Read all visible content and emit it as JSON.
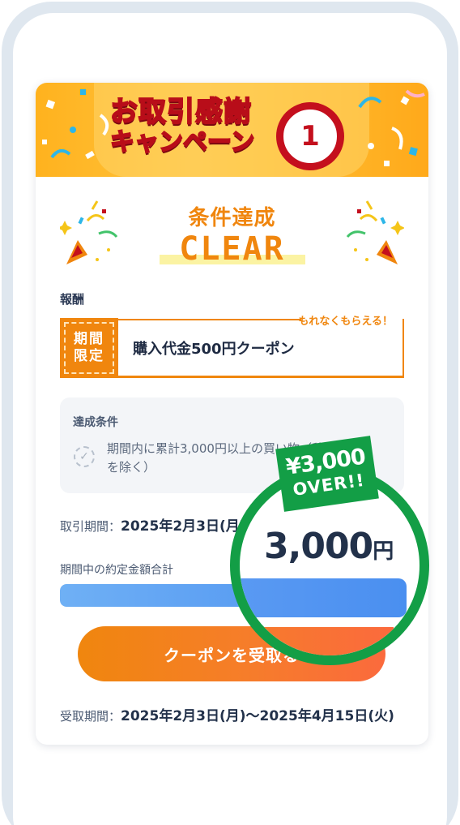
{
  "banner": {
    "title_line1": "お取引感謝",
    "title_line2": "キャンペーン",
    "number": "1"
  },
  "status": {
    "title": "条件達成",
    "label": "CLEAR"
  },
  "reward": {
    "section_label": "報酬",
    "note": "もれなくもらえる！",
    "badge_line1": "期間",
    "badge_line2": "限定",
    "text": "購入代金500円クーポン"
  },
  "condition": {
    "title": "達成条件",
    "text": "期間内に累計3,000円以上の買い物（積立てを除く）"
  },
  "trade_period": {
    "label": "取引期間：",
    "value": "2025年2月3日(月)〜2025年3月3日(月)"
  },
  "total": {
    "label": "期間中の約定金額合計",
    "progress_fraction": 1.0
  },
  "cta": {
    "label": "クーポンを受取る"
  },
  "receive_period": {
    "label": "受取期間：",
    "value": "2025年2月3日(月)〜2025年4月15日(火)"
  },
  "magnifier": {
    "amount": "3,000",
    "unit": "円",
    "badge_line1": "¥3,000",
    "badge_line2": "OVER!!"
  },
  "colors": {
    "accent_orange": "#f0860e",
    "accent_green": "#139e46",
    "accent_blue": "#4a8ff0",
    "banner_red": "#c40f1d"
  }
}
